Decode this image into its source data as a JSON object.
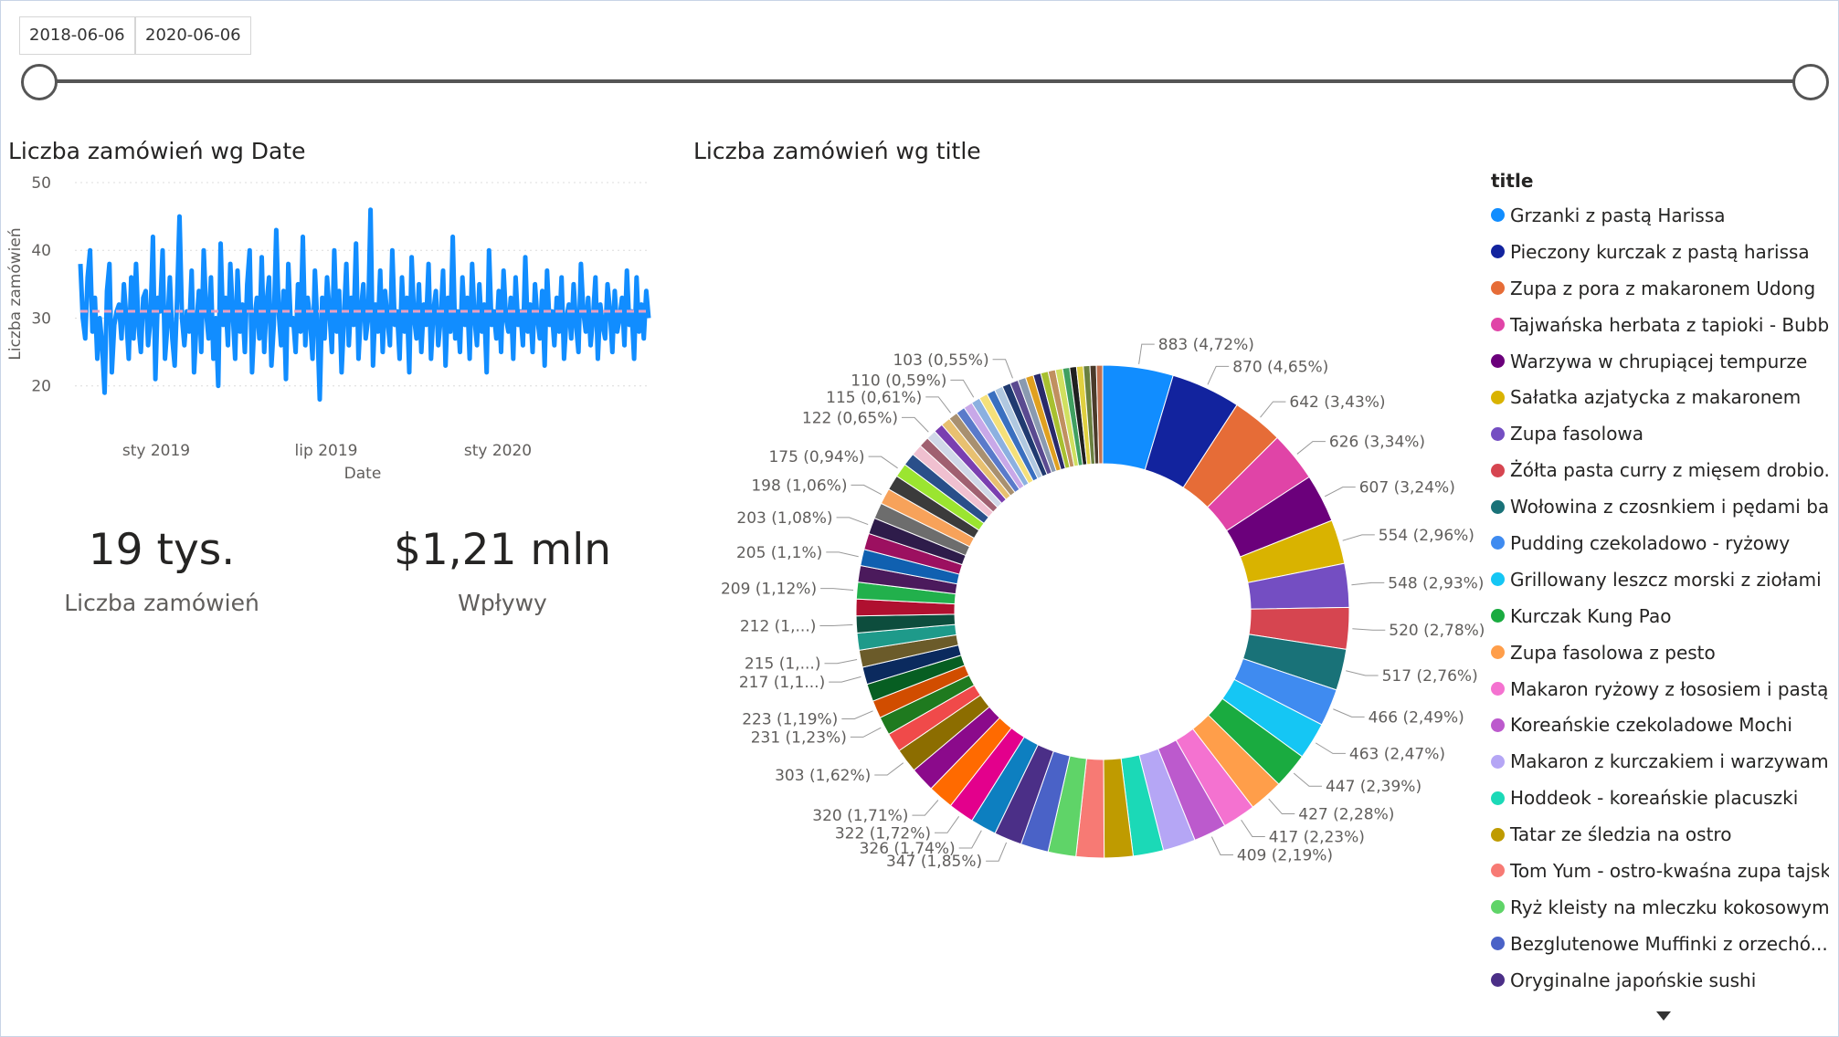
{
  "slicer": {
    "start": "2018-06-06",
    "end": "2020-06-06",
    "value_range": [
      0,
      1
    ]
  },
  "line_chart": {
    "title": "Liczba zamówień wg Date",
    "ylabel": "Liczba zamówień",
    "xlabel": "Date"
  },
  "cards": [
    {
      "value": "19 tys.",
      "label": "Liczba zamówień"
    },
    {
      "value": "$1,21 mln",
      "label": "Wpływy"
    }
  ],
  "donut": {
    "title": "Liczba zamówień wg title",
    "legend_title": "title"
  },
  "chart_data": [
    {
      "type": "line",
      "title": "Liczba zamówień wg Date",
      "xlabel": "Date",
      "ylabel": "Liczba zamówień",
      "ylim": [
        17,
        50
      ],
      "yticks": [
        20,
        30,
        40,
        50
      ],
      "xticks": [
        "sty 2019",
        "lip 2019",
        "sty 2020"
      ],
      "grid": true,
      "reference_line": 31,
      "color": "#118DFF",
      "reference_color": "#E8A0C0",
      "series": [
        {
          "values": [
            38,
            30,
            27,
            36,
            40,
            28,
            33,
            24,
            30,
            26,
            19,
            34,
            38,
            22,
            29,
            31,
            32,
            27,
            35,
            30,
            24,
            36,
            27,
            38,
            29,
            25,
            33,
            34,
            26,
            30,
            42,
            21,
            33,
            31,
            40,
            24,
            29,
            36,
            27,
            23,
            33,
            45,
            30,
            26,
            31,
            28,
            37,
            22,
            29,
            34,
            25,
            40,
            31,
            27,
            36,
            24,
            30,
            20,
            41,
            29,
            33,
            26,
            38,
            31,
            24,
            37,
            28,
            32,
            25,
            35,
            40,
            22,
            30,
            33,
            27,
            39,
            25,
            32,
            36,
            23,
            29,
            43,
            31,
            26,
            34,
            21,
            38,
            29,
            30,
            25,
            35,
            28,
            42,
            26,
            33,
            30,
            24,
            37,
            29,
            18,
            33,
            27,
            36,
            31,
            25,
            40,
            28,
            34,
            22,
            30,
            38,
            26,
            33,
            29,
            41,
            24,
            31,
            35,
            27,
            30,
            46,
            23,
            32,
            28,
            37,
            25,
            34,
            30,
            26,
            40,
            29,
            31,
            24,
            36,
            28,
            33,
            22,
            39,
            30,
            27,
            35,
            25,
            32,
            29,
            38,
            24,
            31,
            34,
            26,
            30,
            37,
            23,
            33,
            28,
            42,
            27,
            31,
            25,
            36,
            29,
            33,
            24,
            38,
            30,
            26,
            35,
            28,
            32,
            22,
            40,
            29,
            31,
            27,
            34,
            25,
            37,
            30,
            28,
            33,
            24,
            36,
            29,
            31,
            26,
            39,
            28,
            32,
            25,
            35,
            30,
            27,
            34,
            23,
            37,
            29,
            31,
            26,
            33,
            28,
            36,
            24,
            30,
            32,
            27,
            35,
            29,
            25,
            38,
            31,
            28,
            33,
            26,
            30,
            36,
            24,
            32,
            29,
            27,
            35,
            31,
            25,
            34,
            28,
            30,
            33,
            26,
            37,
            29,
            31,
            24,
            36,
            28,
            32,
            27,
            34,
            30
          ]
        }
      ]
    },
    {
      "type": "pie",
      "title": "Liczba zamówień wg title",
      "inner_radius_ratio": 0.6,
      "slices": [
        {
          "name": "Grzanki z pastą Harissa",
          "value": 883,
          "label": "883 (4,72%)",
          "color": "#118DFF"
        },
        {
          "name": "Pieczony kurczak z pastą harissa",
          "value": 870,
          "label": "870 (4,65%)",
          "color": "#12239E"
        },
        {
          "name": "Zupa z pora z makaronem Udong",
          "value": 642,
          "label": "642 (3,43%)",
          "color": "#E66C37"
        },
        {
          "name": "Tajwańska herbata z tapioki - Bubb...",
          "value": 626,
          "label": "626 (3,34%)",
          "color": "#E044A7"
        },
        {
          "name": "Warzywa w chrupiącej tempurze",
          "value": 607,
          "label": "607 (3,24%)",
          "color": "#6B007B"
        },
        {
          "name": "Sałatka azjatycka z makaronem",
          "value": 554,
          "label": "554 (2,96%)",
          "color": "#D9B300"
        },
        {
          "name": "Zupa fasolowa",
          "value": 548,
          "label": "548 (2,93%)",
          "color": "#744EC2"
        },
        {
          "name": "Żółta pasta curry z mięsem drobio...",
          "value": 520,
          "label": "520 (2,78%)",
          "color": "#D64550"
        },
        {
          "name": "Wołowina z czosnkiem i pędami ba...",
          "value": 517,
          "label": "517 (2,76%)",
          "color": "#197278"
        },
        {
          "name": "Pudding czekoladowo - ryżowy",
          "value": 466,
          "label": "466 (2,49%)",
          "color": "#3F8BF0"
        },
        {
          "name": "Grillowany leszcz morski z ziołami",
          "value": 463,
          "label": "463 (2,47%)",
          "color": "#15C6F4"
        },
        {
          "name": "Kurczak Kung Pao",
          "value": 447,
          "label": "447 (2,39%)",
          "color": "#1AAB40"
        },
        {
          "name": "Zupa fasolowa z pesto",
          "value": 427,
          "label": "427 (2,28%)",
          "color": "#FF9E4A"
        },
        {
          "name": "Makaron ryżowy z łososiem i pastą...",
          "value": 417,
          "label": "417 (2,23%)",
          "color": "#F472D0"
        },
        {
          "name": "Koreańskie czekoladowe Mochi",
          "value": 409,
          "label": "409 (2,19%)",
          "color": "#BC5ACD"
        },
        {
          "name": "Makaron z kurczakiem i warzywam...",
          "value": 409,
          "label": "",
          "color": "#B5A6F5"
        },
        {
          "name": "Hoddeok - koreańskie placuszki",
          "value": 380,
          "label": "",
          "color": "#1BD9B7"
        },
        {
          "name": "Tatar ze śledzia na ostro",
          "value": 360,
          "label": "",
          "color": "#BF9B00"
        },
        {
          "name": "Tom Yum - ostro-kwaśna zupa tajska",
          "value": 350,
          "label": "",
          "color": "#F77A74"
        },
        {
          "name": "Ryż kleisty na mleczku kokosowym...",
          "value": 349,
          "label": "",
          "color": "#5FD468"
        },
        {
          "name": "Bezglutenowe Muffinki z orzechó...",
          "value": 348,
          "label": "",
          "color": "#4A62C7"
        },
        {
          "name": "Oryginalne japońskie sushi",
          "value": 347,
          "label": "347 (1,85%)",
          "color": "#4B2F87"
        },
        {
          "name": "",
          "value": 326,
          "label": "326 (1,74%)",
          "color": "#0D7FC0"
        },
        {
          "name": "",
          "value": 322,
          "label": "322 (1,72%)",
          "color": "#E3008C"
        },
        {
          "name": "",
          "value": 320,
          "label": "320 (1,71%)",
          "color": "#FF6A00"
        },
        {
          "name": "",
          "value": 310,
          "label": "",
          "color": "#8B0A8B"
        },
        {
          "name": "",
          "value": 303,
          "label": "303 (1,62%)",
          "color": "#8C6D00"
        },
        {
          "name": "",
          "value": 240,
          "label": "",
          "color": "#F04A4A"
        },
        {
          "name": "",
          "value": 231,
          "label": "231 (1,23%)",
          "color": "#1F7A1F"
        },
        {
          "name": "",
          "value": 223,
          "label": "223 (1,19%)",
          "color": "#D14D00"
        },
        {
          "name": "",
          "value": 220,
          "label": "",
          "color": "#075E22"
        },
        {
          "name": "",
          "value": 217,
          "label": "217 (1,1...)",
          "color": "#0B2A5E"
        },
        {
          "name": "",
          "value": 215,
          "label": "215 (1,...)",
          "color": "#6B5B2A"
        },
        {
          "name": "",
          "value": 214,
          "label": "",
          "color": "#1E9A8A"
        },
        {
          "name": "",
          "value": 212,
          "label": "212 (1,...)",
          "color": "#0D4D3D"
        },
        {
          "name": "",
          "value": 210,
          "label": "",
          "color": "#B01030"
        },
        {
          "name": "",
          "value": 209,
          "label": "209 (1,12%)",
          "color": "#22B04C"
        },
        {
          "name": "",
          "value": 207,
          "label": "",
          "color": "#4B1A5C"
        },
        {
          "name": "",
          "value": 205,
          "label": "205 (1,1%)",
          "color": "#1060B0"
        },
        {
          "name": "",
          "value": 204,
          "label": "",
          "color": "#9C1060"
        },
        {
          "name": "",
          "value": 203,
          "label": "203 (1,08%)",
          "color": "#2E1C4A"
        },
        {
          "name": "",
          "value": 200,
          "label": "",
          "color": "#6D6D6D"
        },
        {
          "name": "",
          "value": 198,
          "label": "198 (1,06%)",
          "color": "#F7A25A"
        },
        {
          "name": "",
          "value": 190,
          "label": "",
          "color": "#3B3B3B"
        },
        {
          "name": "",
          "value": 175,
          "label": "175 (0,94%)",
          "color": "#9BE530"
        },
        {
          "name": "",
          "value": 160,
          "label": "",
          "color": "#2A4F8A"
        },
        {
          "name": "",
          "value": 140,
          "label": "",
          "color": "#F0C0D0"
        },
        {
          "name": "",
          "value": 130,
          "label": "",
          "color": "#A06070"
        },
        {
          "name": "",
          "value": 122,
          "label": "122 (0,65%)",
          "color": "#D0D8E8"
        },
        {
          "name": "",
          "value": 120,
          "label": "",
          "color": "#7A3FB0"
        },
        {
          "name": "",
          "value": 118,
          "label": "",
          "color": "#E8C070"
        },
        {
          "name": "",
          "value": 115,
          "label": "115 (0,61%)",
          "color": "#A89070"
        },
        {
          "name": "",
          "value": 113,
          "label": "",
          "color": "#5A7ACA"
        },
        {
          "name": "",
          "value": 112,
          "label": "",
          "color": "#C8A8E8"
        },
        {
          "name": "",
          "value": 110,
          "label": "110 (0,59%)",
          "color": "#8CB0E0"
        },
        {
          "name": "",
          "value": 108,
          "label": "",
          "color": "#F5E07A"
        },
        {
          "name": "",
          "value": 106,
          "label": "",
          "color": "#3A70C0"
        },
        {
          "name": "",
          "value": 105,
          "label": "",
          "color": "#B0C8E0"
        },
        {
          "name": "",
          "value": 104,
          "label": "",
          "color": "#203A70"
        },
        {
          "name": "",
          "value": 103,
          "label": "103 (0,55%)",
          "color": "#5A4A90"
        },
        {
          "name": "",
          "value": 100,
          "label": "",
          "color": "#8A9AB0"
        },
        {
          "name": "",
          "value": 98,
          "label": "",
          "color": "#E0A020"
        },
        {
          "name": "",
          "value": 96,
          "label": "",
          "color": "#2A2A6A"
        },
        {
          "name": "",
          "value": 94,
          "label": "",
          "color": "#A8C030"
        },
        {
          "name": "",
          "value": 92,
          "label": "",
          "color": "#C09060"
        },
        {
          "name": "",
          "value": 90,
          "label": "",
          "color": "#D0E060"
        },
        {
          "name": "",
          "value": 88,
          "label": "",
          "color": "#40A060"
        },
        {
          "name": "",
          "value": 86,
          "label": "",
          "color": "#202020"
        },
        {
          "name": "",
          "value": 84,
          "label": "",
          "color": "#E0D040"
        },
        {
          "name": "",
          "value": 82,
          "label": "",
          "color": "#6A8040"
        },
        {
          "name": "",
          "value": 80,
          "label": "",
          "color": "#4A3A2A"
        },
        {
          "name": "",
          "value": 78,
          "label": "",
          "color": "#C07050"
        }
      ]
    }
  ]
}
